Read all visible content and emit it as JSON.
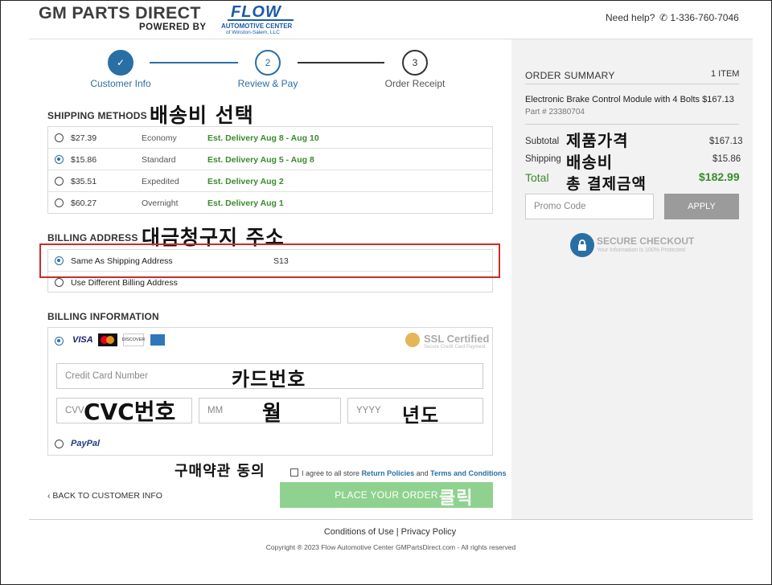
{
  "header": {
    "logo_main": "GM PARTS DIRECT",
    "powered_by": "POWERED BY",
    "partner_logo_word": "FLOW",
    "partner_logo_sub1": "AUTOMOTIVE CENTER",
    "partner_logo_sub2": "of Winston-Salem, LLC",
    "need_help": "Need help?",
    "phone": "1-336-760-7046"
  },
  "progress": {
    "steps": [
      {
        "number": "✓",
        "label": "Customer Info"
      },
      {
        "number": "2",
        "label": "Review & Pay"
      },
      {
        "number": "3",
        "label": "Order Receipt"
      }
    ]
  },
  "shipping": {
    "title": "SHIPPING METHODS",
    "annotation": "배송비 선택",
    "options": [
      {
        "price": "$27.39",
        "speed": "Economy",
        "delivery": "Est. Delivery Aug 8 - Aug 10"
      },
      {
        "price": "$15.86",
        "speed": "Standard",
        "delivery": "Est. Delivery Aug 5 - Aug 8"
      },
      {
        "price": "$35.51",
        "speed": "Expedited",
        "delivery": "Est. Delivery Aug 2"
      },
      {
        "price": "$60.27",
        "speed": "Overnight",
        "delivery": "Est. Delivery Aug 1"
      }
    ]
  },
  "billing_address": {
    "title": "BILLING ADDRESS",
    "annotation": "대금청구지 주소",
    "same_label": "Same As Shipping Address",
    "same_value": "S13",
    "different_label": "Use Different Billing Address"
  },
  "billing_info": {
    "title": "BILLING INFORMATION",
    "card_brands": [
      "VISA",
      "mastercard",
      "DISCOVER",
      "amex"
    ],
    "ssl_title": "SSL Certified",
    "ssl_sub": "Secure Credit Card Payment",
    "card_number_placeholder": "Credit Card Number",
    "card_number_annotation": "카드번호",
    "cvv_placeholder": "CVV",
    "cvv_annotation": "CVC번호",
    "month_placeholder": "MM",
    "month_annotation": "월",
    "year_placeholder": "YYYY",
    "year_annotation": "년도",
    "paypal": "PayPal"
  },
  "agreement": {
    "annotation": "구매약관 동의",
    "text_prefix": "I agree to all store",
    "link1": "Return Policies",
    "and": "and",
    "link2": "Terms and Conditions"
  },
  "actions": {
    "back_label": "BACK TO CUSTOMER INFO",
    "place_order": "PLACE YOUR ORDER",
    "place_order_annotation": "클릭"
  },
  "summary": {
    "title": "ORDER SUMMARY",
    "count": "1 ITEM",
    "item_name": "Electronic Brake Control Module with 4 Bolts",
    "item_price": "$167.13",
    "part_number": "Part # 23380704",
    "subtotal_label": "Subtotal",
    "subtotal_annotation": "제품가격",
    "subtotal_value": "$167.13",
    "shipping_label": "Shipping",
    "shipping_annotation": "배송비",
    "shipping_value": "$15.86",
    "total_label": "Total",
    "total_annotation": "총 결제금액",
    "total_value": "$182.99",
    "promo_placeholder": "Promo Code",
    "apply_label": "APPLY",
    "secure_title": "SECURE CHECKOUT",
    "secure_sub": "Your Information is 100% Protected"
  },
  "footer": {
    "conditions": "Conditions of Use",
    "sep": "|",
    "privacy": "Privacy Policy",
    "copyright": "Copyright ® 2023 Flow Automotive Center GMPartsDirect.com - All rights reserved"
  },
  "colors": {
    "accent": "#2a6fa4",
    "green": "#3a8a2e",
    "button_green": "#8fd28f",
    "highlight_red": "#cc2b2b"
  }
}
